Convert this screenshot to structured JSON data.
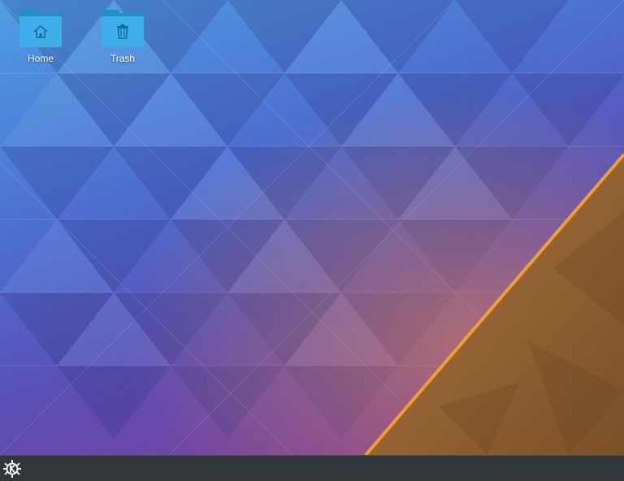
{
  "desktop": {
    "icons": [
      {
        "label": "Home",
        "icon": "home-icon"
      },
      {
        "label": "Trash",
        "icon": "trash-icon"
      }
    ],
    "wallpaper": "kde-plasma-default",
    "colors": {
      "folder_light": "#3daee9",
      "folder_dark": "#1d8fc9",
      "accent_orange": "#f0a030",
      "panel_bg": "#31363b"
    }
  },
  "panel": {
    "launcher_icon": "kde-logo-icon"
  }
}
